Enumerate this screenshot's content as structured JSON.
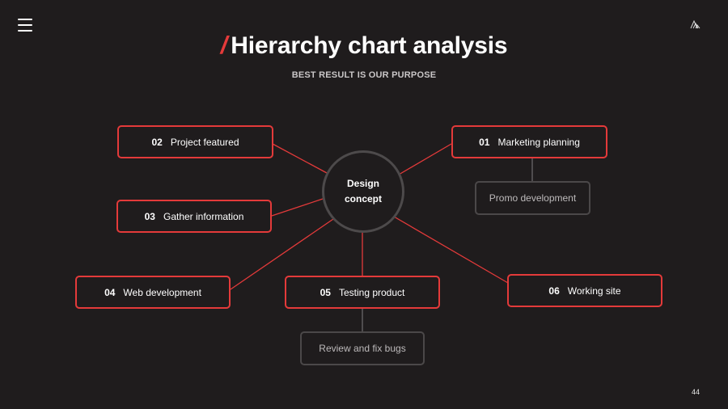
{
  "title": {
    "slash": "/",
    "text": "Hierarchy chart analysis",
    "subtitle": "BEST RESULT IS OUR PURPOSE"
  },
  "center": {
    "line1": "Design",
    "line2": "concept"
  },
  "nodes": [
    {
      "num": "01",
      "label": "Marketing planning"
    },
    {
      "num": "02",
      "label": "Project featured"
    },
    {
      "num": "03",
      "label": "Gather information"
    },
    {
      "num": "04",
      "label": "Web development"
    },
    {
      "num": "05",
      "label": "Testing product"
    },
    {
      "num": "06",
      "label": "Working site"
    }
  ],
  "sub_nodes": [
    {
      "label": "Promo development",
      "parent": "01"
    },
    {
      "label": "Review and fix bugs",
      "parent": "05"
    }
  ],
  "page_number": "44",
  "colors": {
    "background": "#1f1c1d",
    "accent": "#e43a3a",
    "muted_border": "#4b4849",
    "connector_gray": "#6a6768"
  }
}
